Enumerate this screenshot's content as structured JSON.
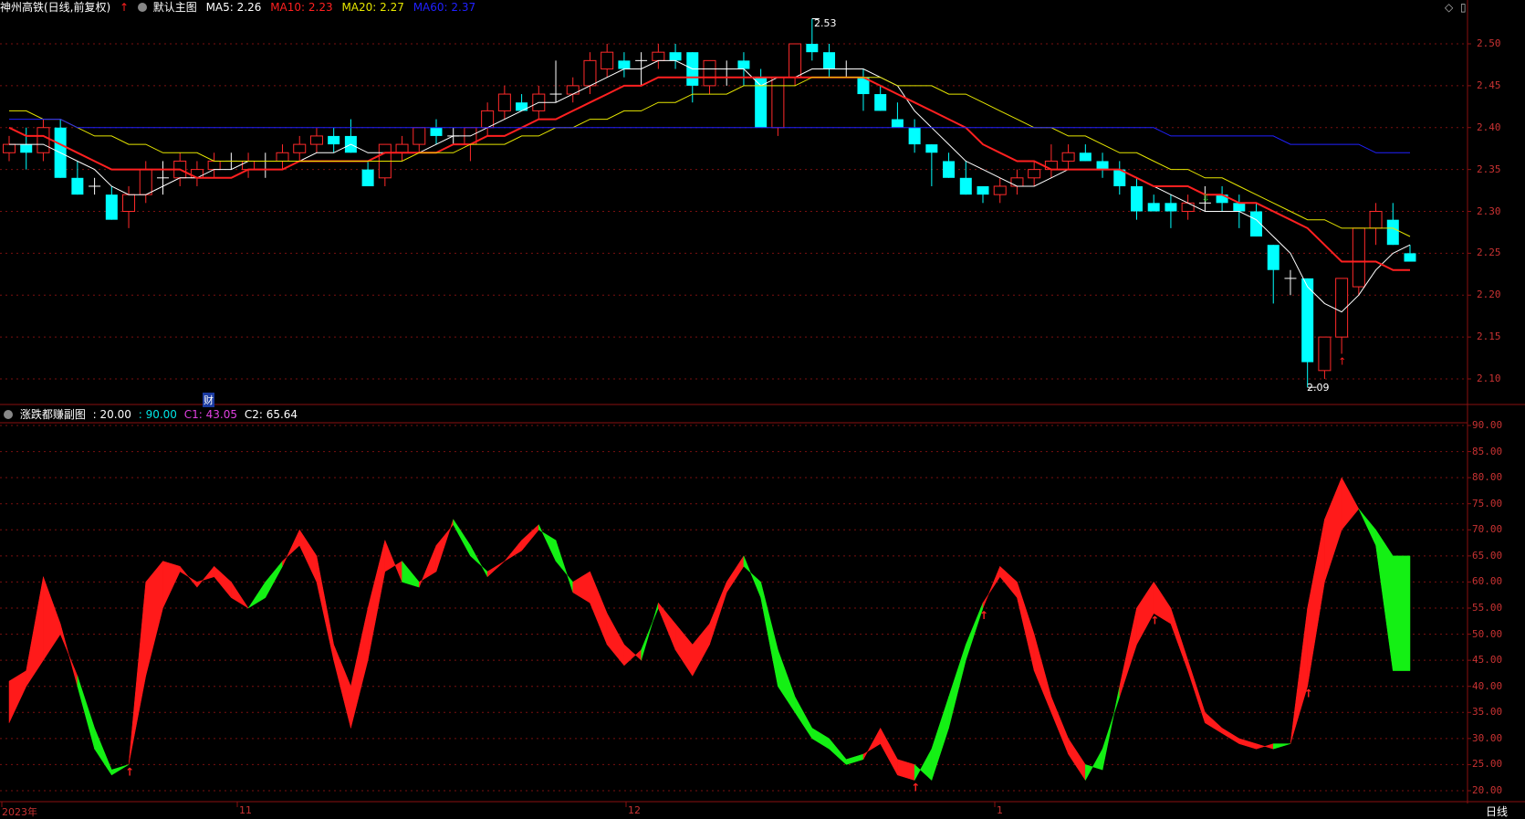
{
  "header": {
    "stock_name": "神州高铁(日线,前复权)",
    "indicator_label": "默认主图",
    "ma5": "MA5: 2.26",
    "ma10": "MA10: 2.23",
    "ma20": "MA20: 2.27",
    "ma60": "MA60: 2.37"
  },
  "sub_header": {
    "title": "涨跌都赚副图",
    "v1": ": 20.00",
    "v2": ": 90.00",
    "c1": "C1: 43.05",
    "c2": "C2: 65.64"
  },
  "main_axis": [
    "2.50",
    "2.45",
    "2.40",
    "2.35",
    "2.30",
    "2.25",
    "2.20",
    "2.15",
    "2.10"
  ],
  "sub_axis": [
    "90.00",
    "85.00",
    "80.00",
    "75.00",
    "70.00",
    "65.00",
    "60.00",
    "55.00",
    "50.00",
    "45.00",
    "40.00",
    "35.00",
    "30.00",
    "25.00",
    "20.00"
  ],
  "dates": [
    "2023年",
    "11",
    "12",
    "1"
  ],
  "period_label": "日线",
  "high_label": "2.53",
  "low_label": "2.09",
  "finance_tag": "财",
  "colors": {
    "up": "#ff2a2a",
    "down": "#00ffff",
    "ma5": "#ffffff",
    "ma10": "#ff2020",
    "ma20": "#e6e600",
    "ma60": "#2020ff",
    "grid": "#7a1010",
    "band_up": "#ff1a1a",
    "band_down": "#14f014"
  },
  "chart_data": [
    {
      "type": "candlestick",
      "title": "神州高铁(日线,前复权)",
      "ylim": [
        2.07,
        2.53
      ],
      "series": [
        {
          "name": "K",
          "ohlc": [
            [
              2.37,
              2.39,
              2.36,
              2.38
            ],
            [
              2.38,
              2.4,
              2.35,
              2.37
            ],
            [
              2.37,
              2.41,
              2.36,
              2.4
            ],
            [
              2.4,
              2.41,
              2.34,
              2.34
            ],
            [
              2.34,
              2.36,
              2.32,
              2.32
            ],
            [
              2.33,
              2.34,
              2.32,
              2.33
            ],
            [
              2.32,
              2.33,
              2.29,
              2.29
            ],
            [
              2.3,
              2.33,
              2.28,
              2.32
            ],
            [
              2.32,
              2.36,
              2.31,
              2.35
            ],
            [
              2.34,
              2.36,
              2.32,
              2.34
            ],
            [
              2.34,
              2.37,
              2.33,
              2.36
            ],
            [
              2.34,
              2.36,
              2.33,
              2.35
            ],
            [
              2.35,
              2.37,
              2.34,
              2.36
            ],
            [
              2.36,
              2.37,
              2.35,
              2.36
            ],
            [
              2.35,
              2.37,
              2.34,
              2.36
            ],
            [
              2.35,
              2.37,
              2.34,
              2.35
            ],
            [
              2.36,
              2.38,
              2.35,
              2.37
            ],
            [
              2.37,
              2.39,
              2.36,
              2.38
            ],
            [
              2.38,
              2.4,
              2.37,
              2.39
            ],
            [
              2.39,
              2.4,
              2.37,
              2.38
            ],
            [
              2.39,
              2.41,
              2.37,
              2.37
            ],
            [
              2.35,
              2.36,
              2.33,
              2.33
            ],
            [
              2.34,
              2.38,
              2.33,
              2.38
            ],
            [
              2.37,
              2.39,
              2.36,
              2.38
            ],
            [
              2.38,
              2.4,
              2.37,
              2.4
            ],
            [
              2.4,
              2.41,
              2.38,
              2.39
            ],
            [
              2.39,
              2.4,
              2.38,
              2.39
            ],
            [
              2.38,
              2.4,
              2.36,
              2.4
            ],
            [
              2.4,
              2.43,
              2.39,
              2.42
            ],
            [
              2.42,
              2.45,
              2.41,
              2.44
            ],
            [
              2.43,
              2.44,
              2.42,
              2.42
            ],
            [
              2.42,
              2.45,
              2.41,
              2.44
            ],
            [
              2.44,
              2.48,
              2.43,
              2.44
            ],
            [
              2.44,
              2.46,
              2.43,
              2.45
            ],
            [
              2.45,
              2.49,
              2.44,
              2.48
            ],
            [
              2.47,
              2.5,
              2.46,
              2.49
            ],
            [
              2.48,
              2.49,
              2.46,
              2.47
            ],
            [
              2.48,
              2.49,
              2.45,
              2.48
            ],
            [
              2.48,
              2.5,
              2.47,
              2.49
            ],
            [
              2.49,
              2.5,
              2.47,
              2.48
            ],
            [
              2.49,
              2.49,
              2.43,
              2.45
            ],
            [
              2.45,
              2.48,
              2.44,
              2.48
            ],
            [
              2.47,
              2.48,
              2.45,
              2.47
            ],
            [
              2.48,
              2.49,
              2.45,
              2.47
            ],
            [
              2.46,
              2.47,
              2.4,
              2.4
            ],
            [
              2.4,
              2.45,
              2.39,
              2.46
            ],
            [
              2.46,
              2.5,
              2.45,
              2.5
            ],
            [
              2.5,
              2.53,
              2.48,
              2.49
            ],
            [
              2.49,
              2.5,
              2.46,
              2.47
            ],
            [
              2.47,
              2.48,
              2.46,
              2.47
            ],
            [
              2.46,
              2.47,
              2.42,
              2.44
            ],
            [
              2.44,
              2.45,
              2.42,
              2.42
            ],
            [
              2.41,
              2.43,
              2.4,
              2.4
            ],
            [
              2.4,
              2.41,
              2.37,
              2.38
            ],
            [
              2.38,
              2.38,
              2.33,
              2.37
            ],
            [
              2.36,
              2.37,
              2.34,
              2.34
            ],
            [
              2.34,
              2.36,
              2.32,
              2.32
            ],
            [
              2.33,
              2.33,
              2.31,
              2.32
            ],
            [
              2.32,
              2.34,
              2.31,
              2.33
            ],
            [
              2.33,
              2.35,
              2.32,
              2.34
            ],
            [
              2.34,
              2.36,
              2.33,
              2.35
            ],
            [
              2.35,
              2.38,
              2.34,
              2.36
            ],
            [
              2.36,
              2.38,
              2.35,
              2.37
            ],
            [
              2.37,
              2.38,
              2.36,
              2.36
            ],
            [
              2.36,
              2.37,
              2.34,
              2.35
            ],
            [
              2.35,
              2.36,
              2.32,
              2.33
            ],
            [
              2.33,
              2.34,
              2.29,
              2.3
            ],
            [
              2.31,
              2.32,
              2.3,
              2.3
            ],
            [
              2.31,
              2.32,
              2.28,
              2.3
            ],
            [
              2.3,
              2.32,
              2.29,
              2.31
            ],
            [
              2.31,
              2.33,
              2.3,
              2.31
            ],
            [
              2.32,
              2.33,
              2.3,
              2.31
            ],
            [
              2.31,
              2.32,
              2.28,
              2.3
            ],
            [
              2.3,
              2.31,
              2.27,
              2.27
            ],
            [
              2.26,
              2.26,
              2.19,
              2.23
            ],
            [
              2.22,
              2.23,
              2.2,
              2.22
            ],
            [
              2.22,
              2.22,
              2.09,
              2.12
            ],
            [
              2.11,
              2.15,
              2.1,
              2.15
            ],
            [
              2.15,
              2.22,
              2.13,
              2.22
            ],
            [
              2.21,
              2.28,
              2.2,
              2.28
            ],
            [
              2.28,
              2.31,
              2.26,
              2.3
            ],
            [
              2.29,
              2.31,
              2.26,
              2.26
            ],
            [
              2.25,
              2.26,
              2.24,
              2.24
            ]
          ]
        },
        {
          "name": "MA5",
          "values": [
            2.38,
            2.38,
            2.38,
            2.37,
            2.36,
            2.35,
            2.33,
            2.32,
            2.32,
            2.33,
            2.34,
            2.34,
            2.35,
            2.35,
            2.36,
            2.36,
            2.36,
            2.36,
            2.37,
            2.37,
            2.38,
            2.37,
            2.37,
            2.37,
            2.37,
            2.38,
            2.39,
            2.39,
            2.4,
            2.41,
            2.42,
            2.43,
            2.43,
            2.44,
            2.45,
            2.46,
            2.47,
            2.47,
            2.48,
            2.48,
            2.47,
            2.47,
            2.47,
            2.47,
            2.45,
            2.46,
            2.46,
            2.47,
            2.47,
            2.47,
            2.47,
            2.46,
            2.45,
            2.42,
            2.4,
            2.38,
            2.36,
            2.35,
            2.34,
            2.33,
            2.33,
            2.34,
            2.35,
            2.35,
            2.35,
            2.35,
            2.34,
            2.33,
            2.32,
            2.31,
            2.3,
            2.3,
            2.3,
            2.29,
            2.27,
            2.25,
            2.21,
            2.19,
            2.18,
            2.2,
            2.23,
            2.25,
            2.26
          ]
        },
        {
          "name": "MA10",
          "values": [
            2.4,
            2.39,
            2.39,
            2.38,
            2.37,
            2.36,
            2.35,
            2.35,
            2.35,
            2.35,
            2.35,
            2.34,
            2.34,
            2.34,
            2.35,
            2.35,
            2.35,
            2.36,
            2.36,
            2.36,
            2.36,
            2.36,
            2.37,
            2.37,
            2.37,
            2.37,
            2.38,
            2.38,
            2.39,
            2.39,
            2.4,
            2.41,
            2.41,
            2.42,
            2.43,
            2.44,
            2.45,
            2.45,
            2.46,
            2.46,
            2.46,
            2.46,
            2.46,
            2.46,
            2.46,
            2.46,
            2.46,
            2.46,
            2.46,
            2.46,
            2.46,
            2.45,
            2.44,
            2.43,
            2.42,
            2.41,
            2.4,
            2.38,
            2.37,
            2.36,
            2.36,
            2.35,
            2.35,
            2.35,
            2.35,
            2.35,
            2.34,
            2.33,
            2.33,
            2.33,
            2.32,
            2.32,
            2.31,
            2.31,
            2.3,
            2.29,
            2.28,
            2.26,
            2.24,
            2.24,
            2.24,
            2.23,
            2.23
          ]
        },
        {
          "name": "MA20",
          "values": [
            2.42,
            2.42,
            2.41,
            2.41,
            2.4,
            2.39,
            2.39,
            2.38,
            2.38,
            2.37,
            2.37,
            2.37,
            2.36,
            2.36,
            2.36,
            2.36,
            2.36,
            2.36,
            2.36,
            2.36,
            2.36,
            2.36,
            2.36,
            2.36,
            2.37,
            2.37,
            2.37,
            2.38,
            2.38,
            2.38,
            2.39,
            2.39,
            2.4,
            2.4,
            2.41,
            2.41,
            2.42,
            2.42,
            2.43,
            2.43,
            2.44,
            2.44,
            2.44,
            2.45,
            2.45,
            2.45,
            2.45,
            2.46,
            2.46,
            2.46,
            2.46,
            2.46,
            2.45,
            2.45,
            2.45,
            2.44,
            2.44,
            2.43,
            2.42,
            2.41,
            2.4,
            2.4,
            2.39,
            2.39,
            2.38,
            2.37,
            2.37,
            2.36,
            2.35,
            2.35,
            2.34,
            2.34,
            2.33,
            2.32,
            2.31,
            2.3,
            2.29,
            2.29,
            2.28,
            2.28,
            2.28,
            2.28,
            2.27
          ]
        },
        {
          "name": "MA60",
          "values": [
            2.41,
            2.41,
            2.41,
            2.41,
            2.4,
            2.4,
            2.4,
            2.4,
            2.4,
            2.4,
            2.4,
            2.4,
            2.4,
            2.4,
            2.4,
            2.4,
            2.4,
            2.4,
            2.4,
            2.4,
            2.4,
            2.4,
            2.4,
            2.4,
            2.4,
            2.4,
            2.4,
            2.4,
            2.4,
            2.4,
            2.4,
            2.4,
            2.4,
            2.4,
            2.4,
            2.4,
            2.4,
            2.4,
            2.4,
            2.4,
            2.4,
            2.4,
            2.4,
            2.4,
            2.4,
            2.4,
            2.4,
            2.4,
            2.4,
            2.4,
            2.4,
            2.4,
            2.4,
            2.4,
            2.4,
            2.4,
            2.4,
            2.4,
            2.4,
            2.4,
            2.4,
            2.4,
            2.4,
            2.4,
            2.4,
            2.4,
            2.4,
            2.4,
            2.39,
            2.39,
            2.39,
            2.39,
            2.39,
            2.39,
            2.39,
            2.38,
            2.38,
            2.38,
            2.38,
            2.38,
            2.37,
            2.37,
            2.37
          ]
        }
      ]
    },
    {
      "type": "area",
      "title": "涨跌都赚副图",
      "ylim": [
        20,
        90
      ],
      "series": [
        {
          "name": "C1",
          "values": [
            41,
            43,
            61,
            52,
            40,
            28,
            23,
            25,
            60,
            64,
            63,
            59,
            63,
            60,
            55,
            57,
            63,
            70,
            65,
            48,
            40,
            55,
            68,
            60,
            59,
            67,
            71,
            65,
            62,
            64,
            68,
            71,
            64,
            60,
            62,
            54,
            48,
            45,
            56,
            52,
            48,
            52,
            60,
            65,
            57,
            40,
            35,
            30,
            28,
            25,
            26,
            32,
            26,
            25,
            22,
            32,
            45,
            55,
            63,
            60,
            50,
            38,
            30,
            25,
            24,
            40,
            55,
            60,
            55,
            45,
            35,
            32,
            30,
            29,
            28,
            29,
            55,
            72,
            80,
            74,
            67,
            43,
            43
          ]
        },
        {
          "name": "C2",
          "values": [
            33,
            40,
            45,
            50,
            42,
            32,
            24,
            25,
            42,
            55,
            62,
            60,
            61,
            57,
            55,
            60,
            64,
            67,
            60,
            45,
            32,
            45,
            62,
            64,
            60,
            62,
            72,
            67,
            61,
            64,
            66,
            70,
            68,
            58,
            56,
            48,
            44,
            47,
            55,
            47,
            42,
            48,
            58,
            63,
            60,
            47,
            38,
            32,
            30,
            26,
            27,
            29,
            23,
            22,
            28,
            38,
            48,
            56,
            61,
            57,
            43,
            35,
            27,
            22,
            28,
            38,
            48,
            54,
            52,
            43,
            33,
            31,
            29,
            28,
            29,
            29,
            40,
            60,
            70,
            74,
            70,
            65,
            65
          ]
        }
      ],
      "signals": "arrows at local minima"
    }
  ]
}
